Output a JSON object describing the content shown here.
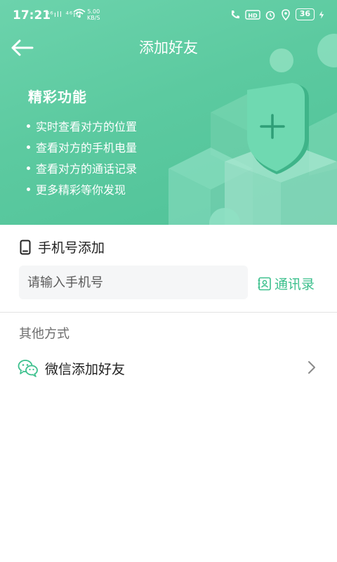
{
  "status_bar": {
    "time": "17:21",
    "signal": "⁴⁶ıll ⁴⁶ıll",
    "net_speed_value": "5.00",
    "net_speed_unit": "KB/S",
    "battery": "36"
  },
  "header": {
    "title": "添加好友",
    "feature_title": "精彩功能",
    "features": [
      "实时查看对方的位置",
      "查看对方的手机电量",
      "查看对方的通话记录",
      "更多精彩等你发现"
    ]
  },
  "phone_add": {
    "heading": "手机号添加",
    "placeholder": "请输入手机号",
    "value": "",
    "contacts_label": "通讯录"
  },
  "other_methods": {
    "heading": "其他方式",
    "wechat_label": "微信添加好友"
  },
  "colors": {
    "accent": "#3cc08d",
    "header_gradient_start": "#6cd3ac",
    "header_gradient_end": "#4fc298"
  }
}
